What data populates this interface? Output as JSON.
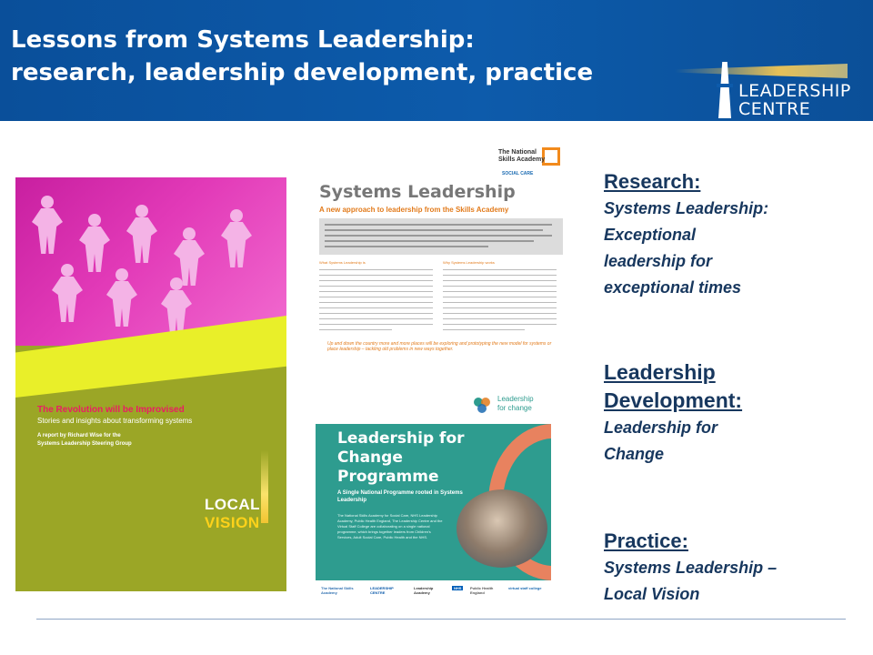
{
  "header": {
    "title_line1": "Lessons from Systems Leadership:",
    "title_line2": "research, leadership development, practice",
    "logo_line1": "LEADERSHIP",
    "logo_line2": "CENTRE"
  },
  "covers": {
    "revolution": {
      "title": "The Revolution will be Improvised",
      "subtitle": "Stories and insights about transforming systems",
      "credit_line1": "A report by Richard Wise for the",
      "credit_line2": "Systems Leadership Steering Group",
      "brand_line1": "LOCAL",
      "brand_line2": "VISION"
    },
    "systems_leadership": {
      "logo_line1": "The National",
      "logo_line2": "Skills Academy",
      "logo_sub": "SOCIAL CARE",
      "title": "Systems Leadership",
      "subtitle": "A new approach to leadership from the Skills Academy",
      "left_heading": "What Systems Leadership is",
      "right_heading": "Why Systems Leadership works",
      "quote": "Up and down the country more and more places will be exploring and prototyping the new model for systems or place leadership – tackling old problems in new ways together."
    },
    "leadership_for_change": {
      "logo_line1": "Leadership",
      "logo_line2": "for change",
      "title": "Leadership for Change Programme",
      "subtitle": "A Single National Programme rooted in Systems Leadership",
      "body": "The National Skills Academy for Social Care, NHS Leadership Academy, Public Health England, The Leadership Centre and the Virtual Staff College are collaborating on a single national programme, which brings together leaders from Children's Services, Adult Social Care, Public Health and the NHS.",
      "footer_logos": [
        "The National Skills Academy",
        "LEADERSHIP CENTRE",
        "Leadership Academy",
        "NHS",
        "Public Health England",
        "virtual staff college"
      ]
    }
  },
  "sections": {
    "research": {
      "heading": "Research:",
      "body_lines": [
        "Systems Leadership:",
        "Exceptional",
        "leadership for",
        "exceptional times"
      ]
    },
    "development": {
      "heading_lines": [
        "Leadership",
        "Development:"
      ],
      "body_lines": [
        "Leadership for",
        "Change"
      ]
    },
    "practice": {
      "heading": "Practice:",
      "body_lines": [
        "Systems Leadership –",
        "Local Vision"
      ]
    }
  },
  "colors": {
    "header_blue": "#0d5bab",
    "text_navy": "#17375e",
    "cover_green": "#9ba626",
    "cover_teal": "#2e9c8f",
    "accent_orange": "#e27b1c"
  }
}
